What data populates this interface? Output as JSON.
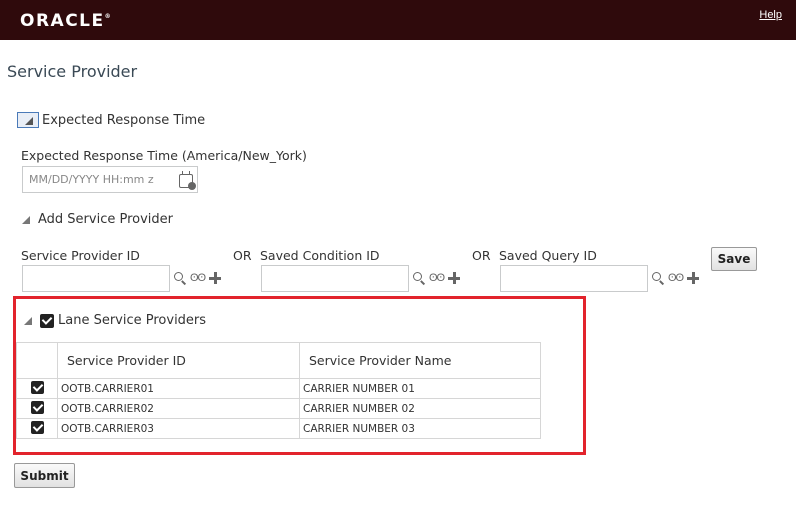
{
  "header": {
    "logo": "ORACLE",
    "logo_mark": "®",
    "help_label": "Help"
  },
  "page": {
    "title": "Service Provider"
  },
  "response_section": {
    "title": "Expected Response Time",
    "field_label": "Expected Response Time (America/New_York)",
    "placeholder": "MM/DD/YYYY HH:mm z",
    "value": ""
  },
  "add_section": {
    "title": "Add Service Provider",
    "or_label": "OR",
    "fields": [
      {
        "label": "Service Provider ID",
        "value": ""
      },
      {
        "label": "Saved Condition ID",
        "value": ""
      },
      {
        "label": "Saved Query ID",
        "value": ""
      }
    ],
    "glasses_glyph": "ʘʘ",
    "save_label": "Save"
  },
  "lane_section": {
    "title": "Lane Service Providers",
    "title_checked": true,
    "columns": [
      "Service Provider ID",
      "Service Provider Name"
    ],
    "rows": [
      {
        "checked": true,
        "id": "OOTB.CARRIER01",
        "name": "CARRIER NUMBER 01"
      },
      {
        "checked": true,
        "id": "OOTB.CARRIER02",
        "name": "CARRIER NUMBER 02"
      },
      {
        "checked": true,
        "id": "OOTB.CARRIER03",
        "name": "CARRIER NUMBER 03"
      }
    ]
  },
  "submit_label": "Submit",
  "colors": {
    "header_bg": "#2f0a0c",
    "highlight_border": "#e2232c",
    "title_color": "#3a4955"
  }
}
